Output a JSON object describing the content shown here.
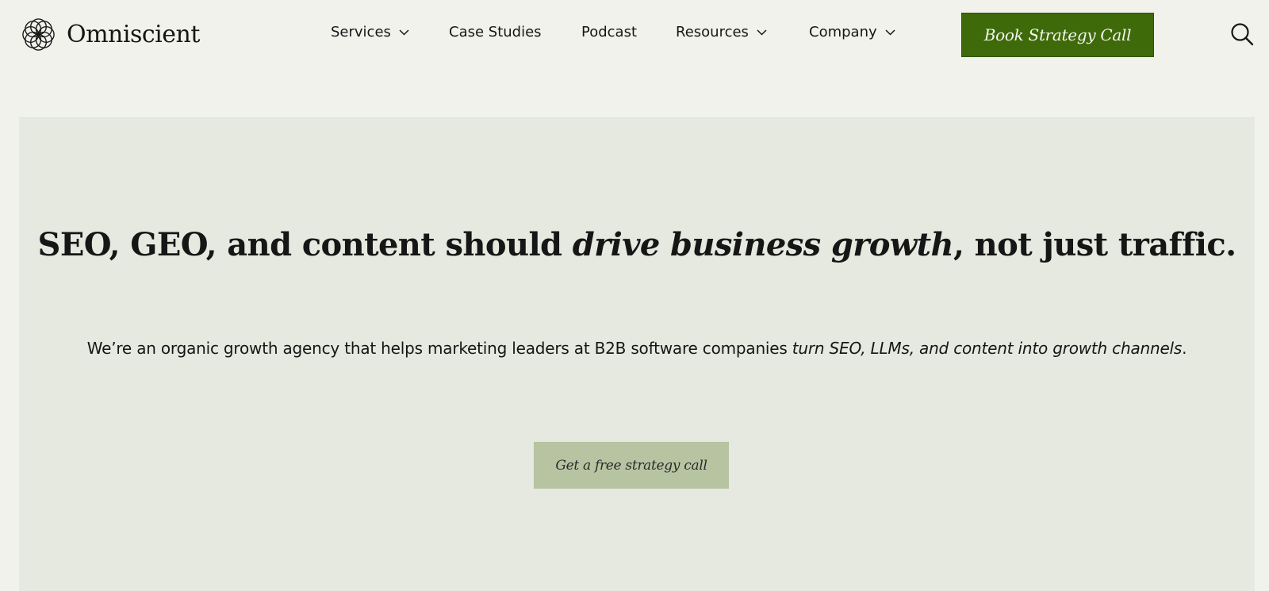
{
  "brand": {
    "name": "Omniscient",
    "logo_icon": "interlaced-circles-logo-icon"
  },
  "nav": {
    "items": [
      {
        "label": "Services",
        "has_dropdown": true
      },
      {
        "label": "Case Studies",
        "has_dropdown": false
      },
      {
        "label": "Podcast",
        "has_dropdown": false
      },
      {
        "label": "Resources",
        "has_dropdown": true
      },
      {
        "label": "Company",
        "has_dropdown": true
      }
    ],
    "cta_label": "Book Strategy Call",
    "search_icon": "search-icon"
  },
  "hero": {
    "title_part1": "SEO, GEO, and content should ",
    "title_em": "drive business growth",
    "title_part2": ", not just traffic.",
    "subtitle_part1": "We’re an organic growth agency that helps marketing leaders at B2B software companies ",
    "subtitle_em": "turn SEO, LLMs, and content into growth channels",
    "subtitle_part2": ".",
    "cta_label": "Get a free strategy call"
  },
  "colors": {
    "page_bg": "#f1f2ec",
    "hero_bg": "#e5e9df",
    "primary_button": "#3e6a0a",
    "secondary_button": "#b7c4a2",
    "text": "#161616"
  }
}
